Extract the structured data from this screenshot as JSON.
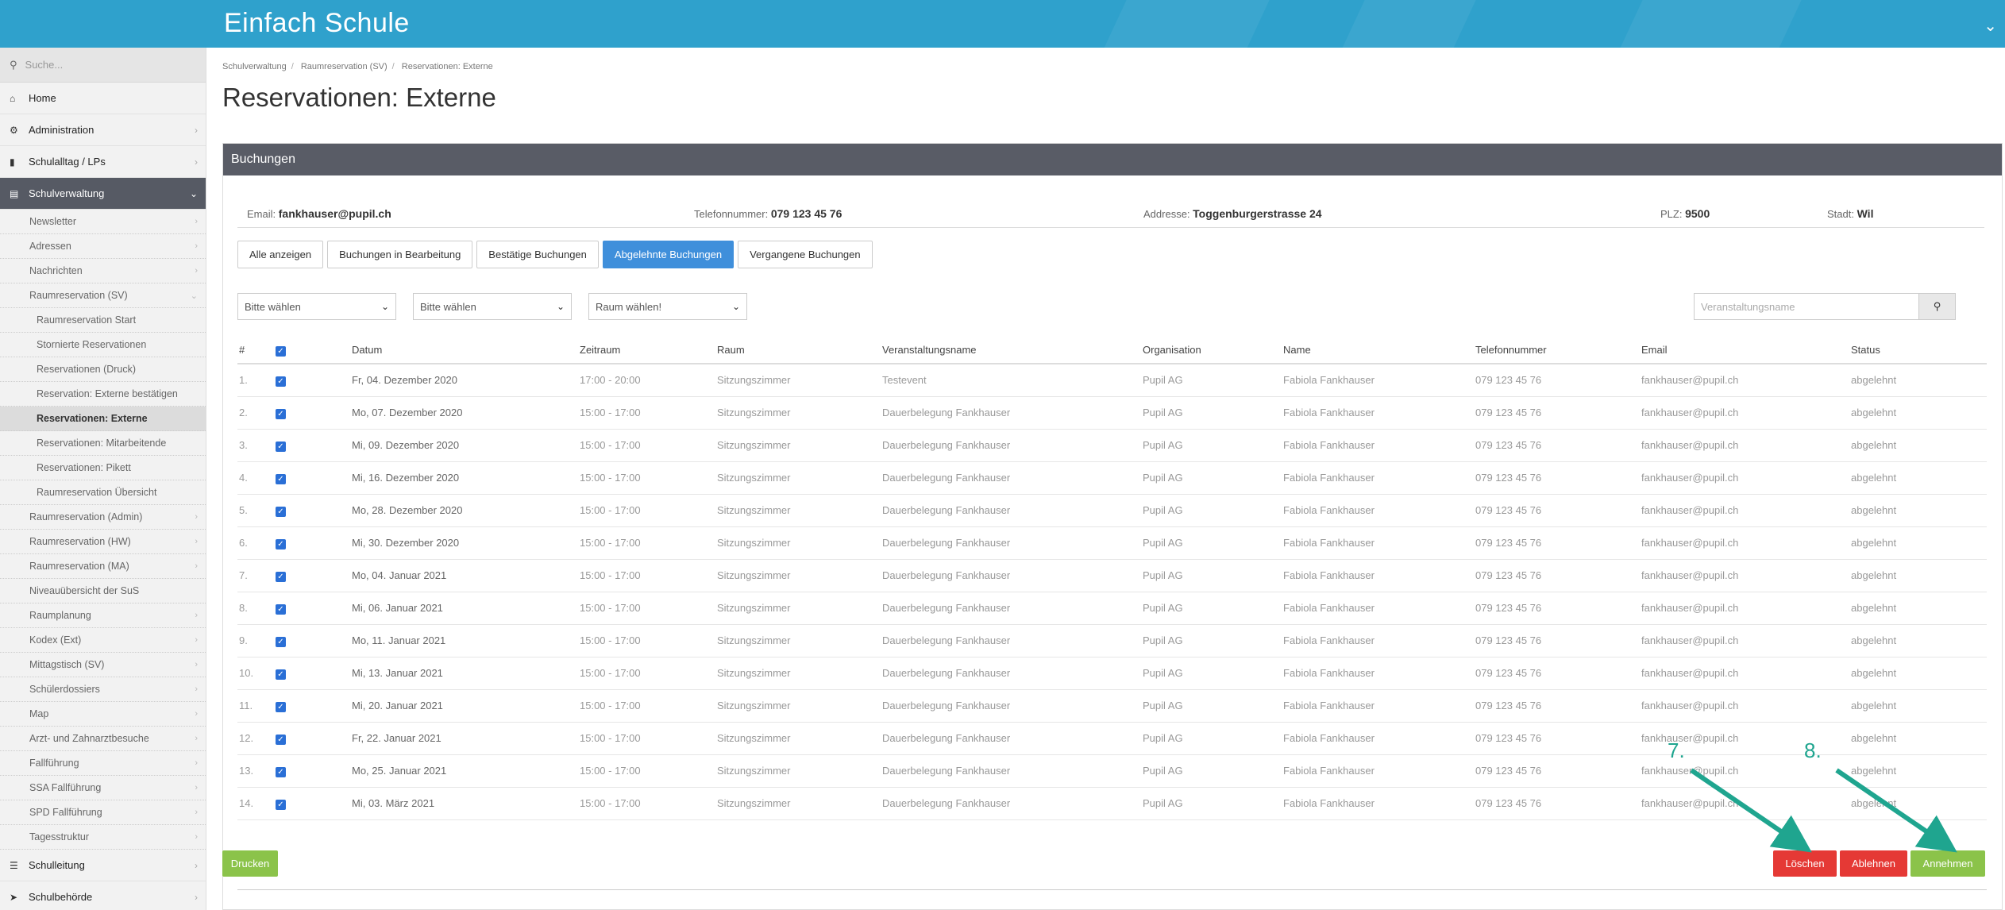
{
  "app": {
    "title": "Einfach Schule"
  },
  "sidebar": {
    "search_placeholder": "Suche...",
    "top_items": [
      {
        "label": "Home",
        "icon": "home-icon"
      },
      {
        "label": "Administration",
        "icon": "cogs-icon"
      },
      {
        "label": "Schulalltag / LPs",
        "icon": "bookmark-icon"
      },
      {
        "label": "Schulverwaltung",
        "icon": "folder-open-icon"
      }
    ],
    "sub_items": [
      "Newsletter",
      "Adressen",
      "Nachrichten",
      "Raumreservation (SV)",
      "Raumreservation Start",
      "Stornierte Reservationen",
      "Reservationen (Druck)",
      "Reservation: Externe bestätigen",
      "Reservationen: Externe",
      "Reservationen: Mitarbeitende",
      "Reservationen: Pikett",
      "Raumreservation Übersicht",
      "Raumreservation (Admin)",
      "Raumreservation (HW)",
      "Raumreservation (MA)",
      "Niveauübersicht der SuS",
      "Raumplanung",
      "Kodex (Ext)",
      "Mittagstisch (SV)",
      "Schülerdossiers",
      "Map",
      "Arzt- und Zahnarztbesuche",
      "Fallführung",
      "SSA Fallführung",
      "SPD Fallführung",
      "Tagesstruktur"
    ],
    "bottom_items": [
      {
        "label": "Schulleitung",
        "icon": "signpost-icon"
      },
      {
        "label": "Schulbehörde",
        "icon": "send-icon"
      }
    ]
  },
  "breadcrumb": [
    "Schulverwaltung",
    "Raumreservation (SV)",
    "Reservationen: Externe"
  ],
  "page_title": "Reservationen: Externe",
  "panel": {
    "title": "Buchungen",
    "info": {
      "email_label": "Email:",
      "email": "fankhauser@pupil.ch",
      "phone_label": "Telefonnummer:",
      "phone": "079 123 45 76",
      "address_label": "Addresse:",
      "address": "Toggenburgerstrasse 24",
      "plz_label": "PLZ:",
      "plz": "9500",
      "city_label": "Stadt:",
      "city": "Wil"
    },
    "tabs": [
      "Alle anzeigen",
      "Buchungen in Bearbeitung",
      "Bestätige Buchungen",
      "Abgelehnte Buchungen",
      "Vergangene Buchungen"
    ],
    "active_tab": "Abgelehnte Buchungen",
    "filters": [
      "Bitte wählen",
      "Bitte wählen",
      "Raum wählen!"
    ],
    "search_placeholder": "Veranstaltungsname",
    "columns": [
      "#",
      "",
      "Datum",
      "Zeitraum",
      "Raum",
      "Veranstaltungsname",
      "Organisation",
      "Name",
      "Telefonnummer",
      "Email",
      "Status"
    ],
    "rows": [
      [
        "1.",
        "Fr, 04. Dezember 2020",
        "17:00 - 20:00",
        "Sitzungszimmer",
        "Testevent",
        "Pupil AG",
        "Fabiola Fankhauser",
        "079 123 45 76",
        "fankhauser@pupil.ch",
        "abgelehnt"
      ],
      [
        "2.",
        "Mo, 07. Dezember 2020",
        "15:00 - 17:00",
        "Sitzungszimmer",
        "Dauerbelegung Fankhauser",
        "Pupil AG",
        "Fabiola Fankhauser",
        "079 123 45 76",
        "fankhauser@pupil.ch",
        "abgelehnt"
      ],
      [
        "3.",
        "Mi, 09. Dezember 2020",
        "15:00 - 17:00",
        "Sitzungszimmer",
        "Dauerbelegung Fankhauser",
        "Pupil AG",
        "Fabiola Fankhauser",
        "079 123 45 76",
        "fankhauser@pupil.ch",
        "abgelehnt"
      ],
      [
        "4.",
        "Mi, 16. Dezember 2020",
        "15:00 - 17:00",
        "Sitzungszimmer",
        "Dauerbelegung Fankhauser",
        "Pupil AG",
        "Fabiola Fankhauser",
        "079 123 45 76",
        "fankhauser@pupil.ch",
        "abgelehnt"
      ],
      [
        "5.",
        "Mo, 28. Dezember 2020",
        "15:00 - 17:00",
        "Sitzungszimmer",
        "Dauerbelegung Fankhauser",
        "Pupil AG",
        "Fabiola Fankhauser",
        "079 123 45 76",
        "fankhauser@pupil.ch",
        "abgelehnt"
      ],
      [
        "6.",
        "Mi, 30. Dezember 2020",
        "15:00 - 17:00",
        "Sitzungszimmer",
        "Dauerbelegung Fankhauser",
        "Pupil AG",
        "Fabiola Fankhauser",
        "079 123 45 76",
        "fankhauser@pupil.ch",
        "abgelehnt"
      ],
      [
        "7.",
        "Mo, 04. Januar 2021",
        "15:00 - 17:00",
        "Sitzungszimmer",
        "Dauerbelegung Fankhauser",
        "Pupil AG",
        "Fabiola Fankhauser",
        "079 123 45 76",
        "fankhauser@pupil.ch",
        "abgelehnt"
      ],
      [
        "8.",
        "Mi, 06. Januar 2021",
        "15:00 - 17:00",
        "Sitzungszimmer",
        "Dauerbelegung Fankhauser",
        "Pupil AG",
        "Fabiola Fankhauser",
        "079 123 45 76",
        "fankhauser@pupil.ch",
        "abgelehnt"
      ],
      [
        "9.",
        "Mo, 11. Januar 2021",
        "15:00 - 17:00",
        "Sitzungszimmer",
        "Dauerbelegung Fankhauser",
        "Pupil AG",
        "Fabiola Fankhauser",
        "079 123 45 76",
        "fankhauser@pupil.ch",
        "abgelehnt"
      ],
      [
        "10.",
        "Mi, 13. Januar 2021",
        "15:00 - 17:00",
        "Sitzungszimmer",
        "Dauerbelegung Fankhauser",
        "Pupil AG",
        "Fabiola Fankhauser",
        "079 123 45 76",
        "fankhauser@pupil.ch",
        "abgelehnt"
      ],
      [
        "11.",
        "Mi, 20. Januar 2021",
        "15:00 - 17:00",
        "Sitzungszimmer",
        "Dauerbelegung Fankhauser",
        "Pupil AG",
        "Fabiola Fankhauser",
        "079 123 45 76",
        "fankhauser@pupil.ch",
        "abgelehnt"
      ],
      [
        "12.",
        "Fr, 22. Januar 2021",
        "15:00 - 17:00",
        "Sitzungszimmer",
        "Dauerbelegung Fankhauser",
        "Pupil AG",
        "Fabiola Fankhauser",
        "079 123 45 76",
        "fankhauser@pupil.ch",
        "abgelehnt"
      ],
      [
        "13.",
        "Mo, 25. Januar 2021",
        "15:00 - 17:00",
        "Sitzungszimmer",
        "Dauerbelegung Fankhauser",
        "Pupil AG",
        "Fabiola Fankhauser",
        "079 123 45 76",
        "fankhauser@pupil.ch",
        "abgelehnt"
      ],
      [
        "14.",
        "Mi, 03. März 2021",
        "15:00 - 17:00",
        "Sitzungszimmer",
        "Dauerbelegung Fankhauser",
        "Pupil AG",
        "Fabiola Fankhauser",
        "079 123 45 76",
        "fankhauser@pupil.ch",
        "abgelehnt"
      ]
    ],
    "buttons": {
      "print": "Drucken",
      "delete": "Löschen",
      "reject": "Ablehnen",
      "accept": "Annehmen"
    },
    "annotations": [
      "7.",
      "8."
    ]
  },
  "colors": {
    "header": "#2fa1cc",
    "panel_head": "#595c66",
    "active_tab": "#3f8fdb",
    "green": "#8bc34a",
    "red": "#e53935",
    "annotation": "#1fa58f"
  }
}
